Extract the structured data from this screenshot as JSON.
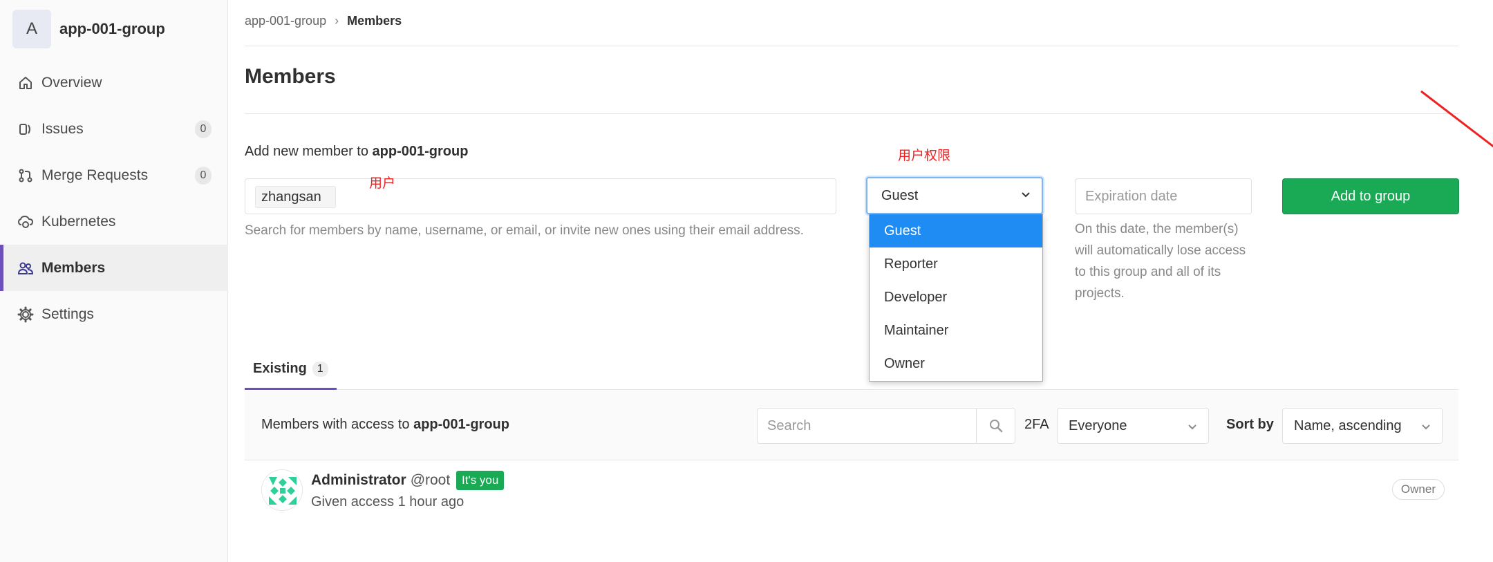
{
  "sidebar": {
    "group_avatar_letter": "A",
    "group_name": "app-001-group",
    "items": [
      {
        "label": "Overview",
        "icon": "home-icon"
      },
      {
        "label": "Issues",
        "icon": "issues-icon",
        "count": "0"
      },
      {
        "label": "Merge Requests",
        "icon": "merge-request-icon",
        "count": "0"
      },
      {
        "label": "Kubernetes",
        "icon": "kubernetes-icon"
      },
      {
        "label": "Members",
        "icon": "users-icon",
        "active": true
      },
      {
        "label": "Settings",
        "icon": "gear-icon"
      }
    ]
  },
  "breadcrumb": {
    "parent": "app-001-group",
    "current": "Members"
  },
  "page_title": "Members",
  "add_member": {
    "label_prefix": "Add new member to",
    "group": "app-001-group",
    "token": "zhangsan",
    "helper": "Search for members by name, username, or email, or invite new ones using their email address.",
    "role_selected": "Guest",
    "role_options": [
      "Guest",
      "Reporter",
      "Developer",
      "Maintainer",
      "Owner"
    ],
    "expiration_placeholder": "Expiration date",
    "expiration_help": "On this date, the member(s) will automatically lose access to this group and all of its projects.",
    "submit_label": "Add to group"
  },
  "annotations": {
    "user": "用户",
    "permission": "用户权限",
    "color": "#ee2222"
  },
  "tabs": [
    {
      "label": "Existing",
      "count": "1"
    }
  ],
  "filter": {
    "prefix": "Members with access to",
    "group": "app-001-group",
    "search_placeholder": "Search",
    "twofa_label": "2FA",
    "twofa_value": "Everyone",
    "sort_label": "Sort by",
    "sort_value": "Name, ascending"
  },
  "members": [
    {
      "name": "Administrator",
      "username": "@root",
      "you_badge": "It's you",
      "access": "Given access 1 hour ago",
      "role": "Owner"
    }
  ],
  "colors": {
    "accent": "#6b4fbb",
    "success": "#1aaa55",
    "selected_option": "#1f8cf3"
  }
}
